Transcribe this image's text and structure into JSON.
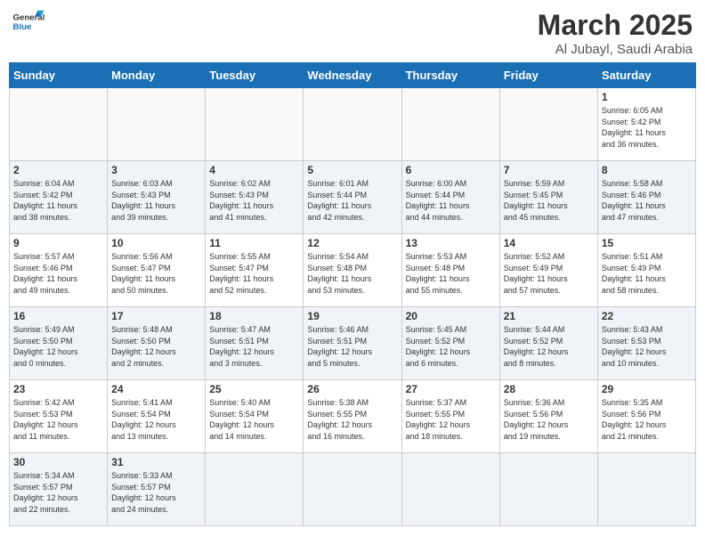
{
  "header": {
    "logo_general": "General",
    "logo_blue": "Blue",
    "month": "March 2025",
    "location": "Al Jubayl, Saudi Arabia"
  },
  "days_of_week": [
    "Sunday",
    "Monday",
    "Tuesday",
    "Wednesday",
    "Thursday",
    "Friday",
    "Saturday"
  ],
  "weeks": [
    [
      {
        "day": "",
        "info": ""
      },
      {
        "day": "",
        "info": ""
      },
      {
        "day": "",
        "info": ""
      },
      {
        "day": "",
        "info": ""
      },
      {
        "day": "",
        "info": ""
      },
      {
        "day": "",
        "info": ""
      },
      {
        "day": "1",
        "info": "Sunrise: 6:05 AM\nSunset: 5:42 PM\nDaylight: 11 hours\nand 36 minutes."
      }
    ],
    [
      {
        "day": "2",
        "info": "Sunrise: 6:04 AM\nSunset: 5:42 PM\nDaylight: 11 hours\nand 38 minutes."
      },
      {
        "day": "3",
        "info": "Sunrise: 6:03 AM\nSunset: 5:43 PM\nDaylight: 11 hours\nand 39 minutes."
      },
      {
        "day": "4",
        "info": "Sunrise: 6:02 AM\nSunset: 5:43 PM\nDaylight: 11 hours\nand 41 minutes."
      },
      {
        "day": "5",
        "info": "Sunrise: 6:01 AM\nSunset: 5:44 PM\nDaylight: 11 hours\nand 42 minutes."
      },
      {
        "day": "6",
        "info": "Sunrise: 6:00 AM\nSunset: 5:44 PM\nDaylight: 11 hours\nand 44 minutes."
      },
      {
        "day": "7",
        "info": "Sunrise: 5:59 AM\nSunset: 5:45 PM\nDaylight: 11 hours\nand 45 minutes."
      },
      {
        "day": "8",
        "info": "Sunrise: 5:58 AM\nSunset: 5:46 PM\nDaylight: 11 hours\nand 47 minutes."
      }
    ],
    [
      {
        "day": "9",
        "info": "Sunrise: 5:57 AM\nSunset: 5:46 PM\nDaylight: 11 hours\nand 49 minutes."
      },
      {
        "day": "10",
        "info": "Sunrise: 5:56 AM\nSunset: 5:47 PM\nDaylight: 11 hours\nand 50 minutes."
      },
      {
        "day": "11",
        "info": "Sunrise: 5:55 AM\nSunset: 5:47 PM\nDaylight: 11 hours\nand 52 minutes."
      },
      {
        "day": "12",
        "info": "Sunrise: 5:54 AM\nSunset: 5:48 PM\nDaylight: 11 hours\nand 53 minutes."
      },
      {
        "day": "13",
        "info": "Sunrise: 5:53 AM\nSunset: 5:48 PM\nDaylight: 11 hours\nand 55 minutes."
      },
      {
        "day": "14",
        "info": "Sunrise: 5:52 AM\nSunset: 5:49 PM\nDaylight: 11 hours\nand 57 minutes."
      },
      {
        "day": "15",
        "info": "Sunrise: 5:51 AM\nSunset: 5:49 PM\nDaylight: 11 hours\nand 58 minutes."
      }
    ],
    [
      {
        "day": "16",
        "info": "Sunrise: 5:49 AM\nSunset: 5:50 PM\nDaylight: 12 hours\nand 0 minutes."
      },
      {
        "day": "17",
        "info": "Sunrise: 5:48 AM\nSunset: 5:50 PM\nDaylight: 12 hours\nand 2 minutes."
      },
      {
        "day": "18",
        "info": "Sunrise: 5:47 AM\nSunset: 5:51 PM\nDaylight: 12 hours\nand 3 minutes."
      },
      {
        "day": "19",
        "info": "Sunrise: 5:46 AM\nSunset: 5:51 PM\nDaylight: 12 hours\nand 5 minutes."
      },
      {
        "day": "20",
        "info": "Sunrise: 5:45 AM\nSunset: 5:52 PM\nDaylight: 12 hours\nand 6 minutes."
      },
      {
        "day": "21",
        "info": "Sunrise: 5:44 AM\nSunset: 5:52 PM\nDaylight: 12 hours\nand 8 minutes."
      },
      {
        "day": "22",
        "info": "Sunrise: 5:43 AM\nSunset: 5:53 PM\nDaylight: 12 hours\nand 10 minutes."
      }
    ],
    [
      {
        "day": "23",
        "info": "Sunrise: 5:42 AM\nSunset: 5:53 PM\nDaylight: 12 hours\nand 11 minutes."
      },
      {
        "day": "24",
        "info": "Sunrise: 5:41 AM\nSunset: 5:54 PM\nDaylight: 12 hours\nand 13 minutes."
      },
      {
        "day": "25",
        "info": "Sunrise: 5:40 AM\nSunset: 5:54 PM\nDaylight: 12 hours\nand 14 minutes."
      },
      {
        "day": "26",
        "info": "Sunrise: 5:38 AM\nSunset: 5:55 PM\nDaylight: 12 hours\nand 16 minutes."
      },
      {
        "day": "27",
        "info": "Sunrise: 5:37 AM\nSunset: 5:55 PM\nDaylight: 12 hours\nand 18 minutes."
      },
      {
        "day": "28",
        "info": "Sunrise: 5:36 AM\nSunset: 5:56 PM\nDaylight: 12 hours\nand 19 minutes."
      },
      {
        "day": "29",
        "info": "Sunrise: 5:35 AM\nSunset: 5:56 PM\nDaylight: 12 hours\nand 21 minutes."
      }
    ],
    [
      {
        "day": "30",
        "info": "Sunrise: 5:34 AM\nSunset: 5:57 PM\nDaylight: 12 hours\nand 22 minutes."
      },
      {
        "day": "31",
        "info": "Sunrise: 5:33 AM\nSunset: 5:57 PM\nDaylight: 12 hours\nand 24 minutes."
      },
      {
        "day": "",
        "info": ""
      },
      {
        "day": "",
        "info": ""
      },
      {
        "day": "",
        "info": ""
      },
      {
        "day": "",
        "info": ""
      },
      {
        "day": "",
        "info": ""
      }
    ]
  ]
}
